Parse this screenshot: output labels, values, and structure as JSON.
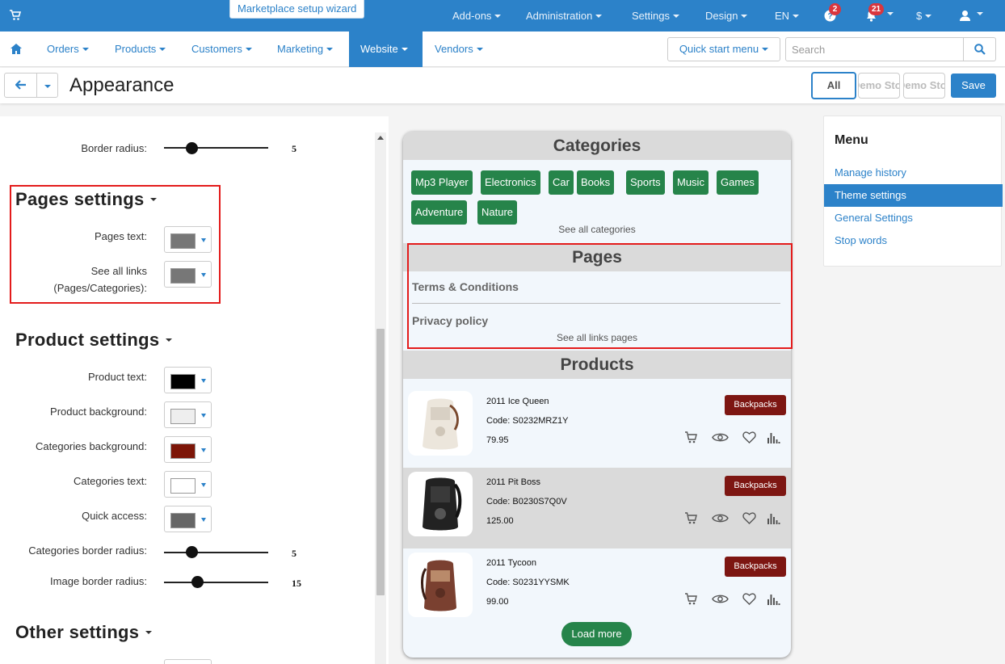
{
  "topbar": {
    "wizard": "Marketplace setup wizard",
    "items": [
      "Add-ons",
      "Administration",
      "Settings",
      "Design",
      "EN"
    ],
    "badge_help": "2",
    "badge_notifications": "21",
    "currency": "$"
  },
  "nav": {
    "items": [
      "Orders",
      "Products",
      "Customers",
      "Marketing",
      "Website",
      "Vendors"
    ],
    "active": "Website",
    "quick_start": "Quick start menu",
    "search_placeholder": "Search"
  },
  "titlebar": {
    "title": "Appearance",
    "store_all": "All",
    "store_1": "Demo Store",
    "store_2": "Demo Store",
    "save": "Save"
  },
  "settings": {
    "border_radius_label": "Border radius:",
    "border_radius_value": 5,
    "pages_section": "Pages settings",
    "pages_text_label": "Pages text:",
    "pages_text_color": "#777777",
    "see_all_links_label_1": "See all links",
    "see_all_links_label_2": "(Pages/Categories):",
    "see_all_links_color": "#777777",
    "product_section": "Product settings",
    "product_text_label": "Product text:",
    "product_text_color": "#000000",
    "product_bg_label": "Product background:",
    "product_bg_color": "#eeeeee",
    "categories_bg_label": "Categories background:",
    "categories_bg_color": "#7d1608",
    "categories_text_label": "Categories text:",
    "categories_text_color": "#ffffff",
    "quick_access_label": "Quick access:",
    "quick_access_color": "#666666",
    "cat_border_radius_label": "Categories border radius:",
    "cat_border_radius_value": 5,
    "img_border_radius_label": "Image border radius:",
    "img_border_radius_value": 15,
    "other_section": "Other settings"
  },
  "preview": {
    "categories_title": "Categories",
    "categories": [
      "Mp3 Player",
      "Electronics",
      "Car",
      "Books",
      "Sports",
      "Music",
      "Games",
      "Adventure",
      "Nature"
    ],
    "see_all_categories": "See all categories",
    "pages_title": "Pages",
    "pages": [
      "Terms & Conditions",
      "Privacy policy"
    ],
    "see_all_pages": "See all links pages",
    "products_title": "Products",
    "products": [
      {
        "name": "2011 Ice Queen",
        "code": "Code: S0232MRZ1Y",
        "price": "79.95",
        "category": "Backpacks"
      },
      {
        "name": "2011 Pit Boss",
        "code": "Code: B0230S7Q0V",
        "price": "125.00",
        "category": "Backpacks"
      },
      {
        "name": "2011 Tycoon",
        "code": "Code: S0231YYSMK",
        "price": "99.00",
        "category": "Backpacks"
      }
    ],
    "load_more": "Load more"
  },
  "menu": {
    "title": "Menu",
    "items": [
      "Manage history",
      "Theme settings",
      "General Settings",
      "Stop words"
    ],
    "active": "Theme settings"
  },
  "colors": {
    "brand": "#2c82c9",
    "green": "#26844a",
    "badge_red": "#7d1612"
  }
}
